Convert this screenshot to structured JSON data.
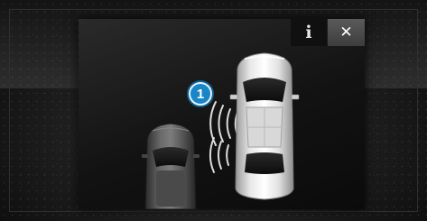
{
  "dialog": {
    "info_label": "i",
    "close_label": "✕",
    "marker_label": "1"
  },
  "icons": [
    "info-icon",
    "close-icon"
  ],
  "colors": {
    "marker": "#1a86c8",
    "close_button": "#4a4a4a",
    "background": "#121212"
  }
}
